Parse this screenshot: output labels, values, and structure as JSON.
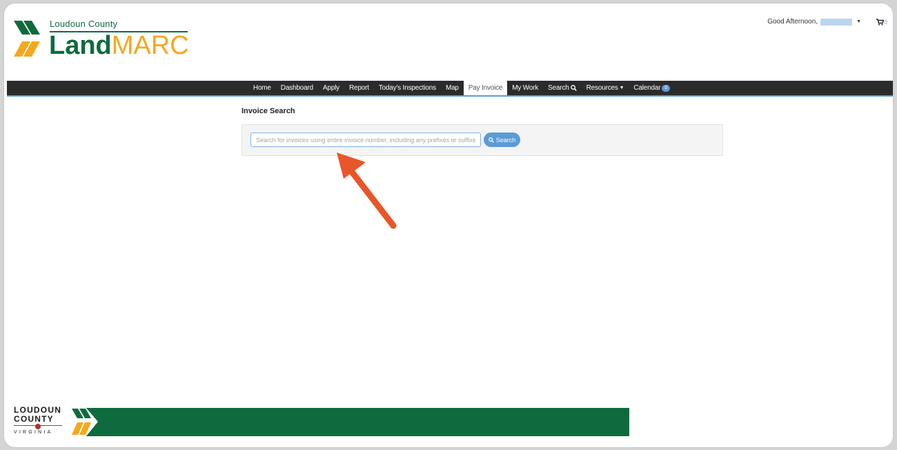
{
  "header": {
    "logo": {
      "county_text": "Loudoun County",
      "brand_part1": "Land",
      "brand_part2": "MARC"
    },
    "greeting_text": "Good Afternoon,",
    "cart_count": "0"
  },
  "nav": {
    "items": [
      {
        "label": "Home"
      },
      {
        "label": "Dashboard"
      },
      {
        "label": "Apply"
      },
      {
        "label": "Report"
      },
      {
        "label": "Today's Inspections"
      },
      {
        "label": "Map"
      },
      {
        "label": "Pay Invoice",
        "active": true
      },
      {
        "label": "My Work"
      },
      {
        "label": "Search"
      },
      {
        "label": "Resources"
      },
      {
        "label": "Calendar",
        "badge": "0"
      }
    ]
  },
  "main": {
    "title": "Invoice Search",
    "search": {
      "placeholder": "Search for invoices using entire invoice number, including any prefixes or suffixes",
      "value": "",
      "button_label": "Search"
    }
  },
  "footer": {
    "logo_line1": "LOUDOUN",
    "logo_line2": "COUNTY",
    "logo_line3": "VIRGINIA"
  },
  "colors": {
    "brand_green": "#0e6b3e",
    "brand_orange": "#f5a81c",
    "navbar_bg": "#2b2b2b",
    "accent_blue": "#5b9bd5",
    "annotation_arrow": "#e8562a"
  }
}
